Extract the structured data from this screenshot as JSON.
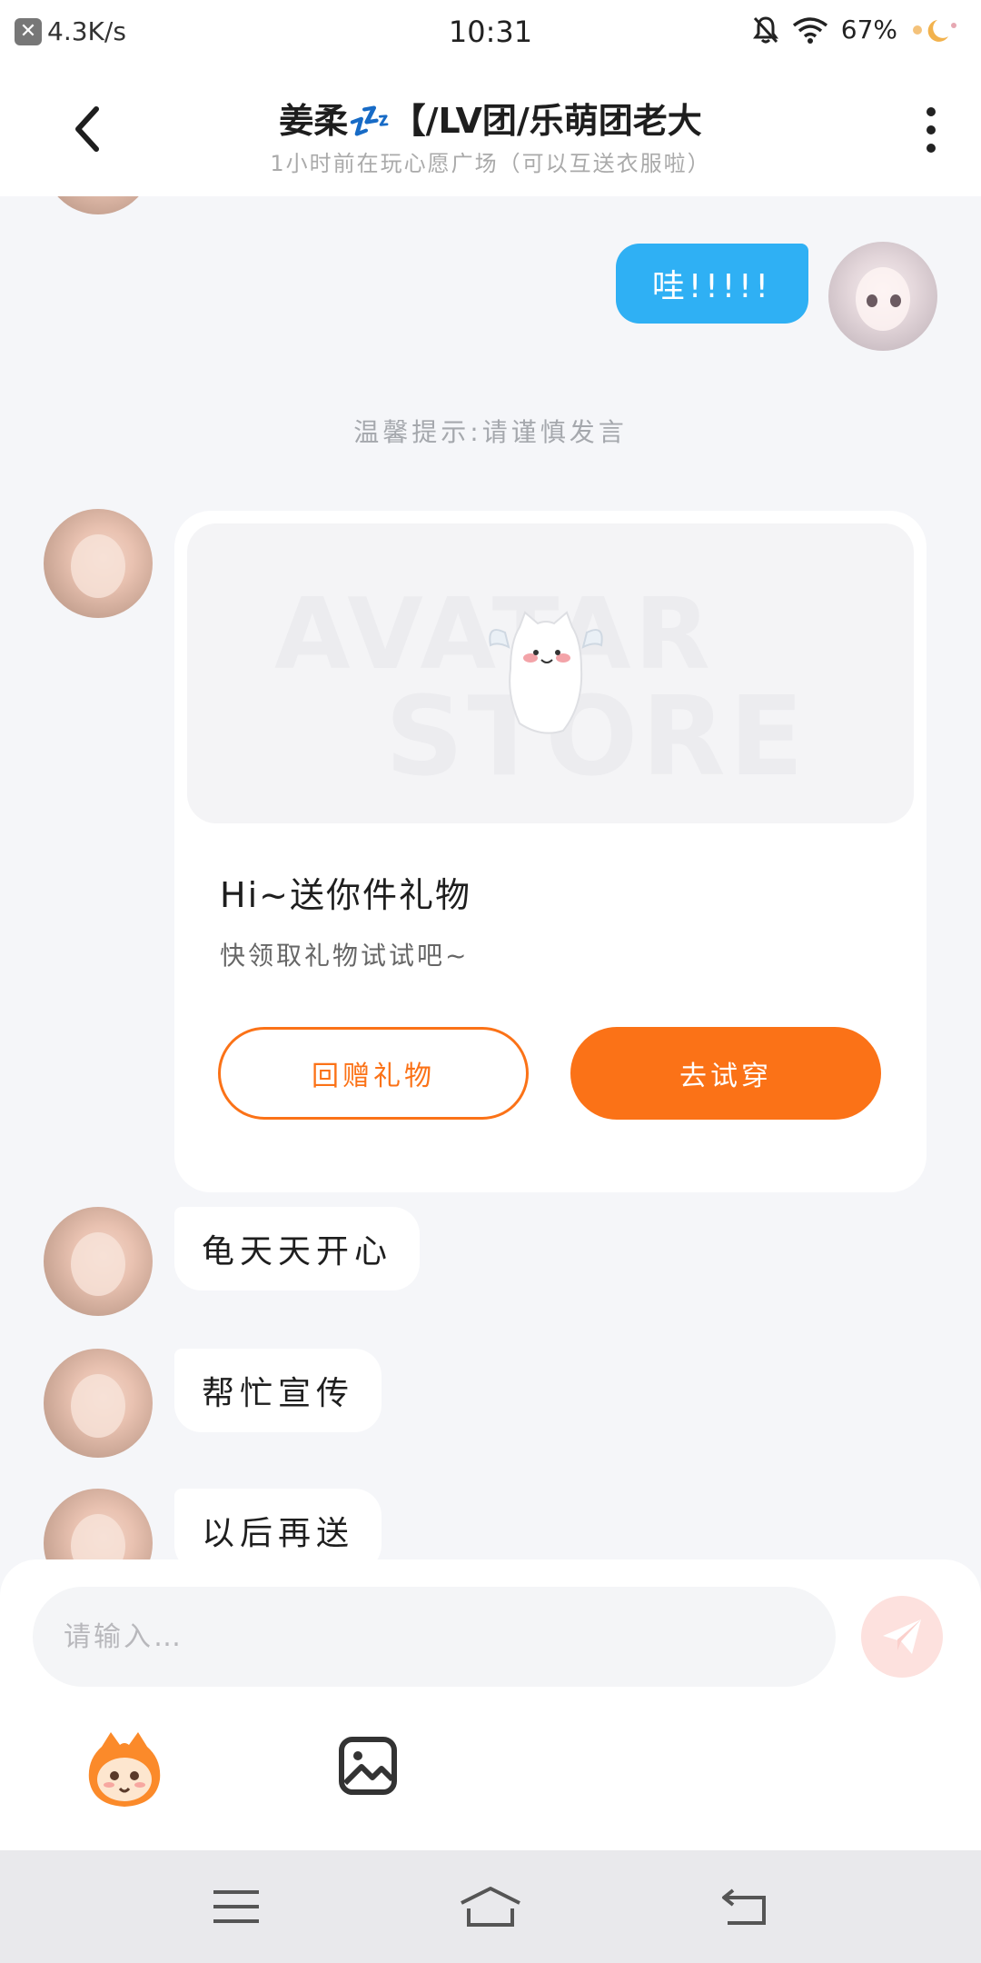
{
  "status_bar": {
    "net_speed": "4.3K/s",
    "time": "10:31",
    "battery": "67%"
  },
  "header": {
    "title": "姜柔💤【/LV团/乐萌团老大",
    "subtitle": "1小时前在玩心愿广场（可以互送衣服啦）"
  },
  "messages": {
    "outgoing_1": "哇!!!!!",
    "tip": "温馨提示:请谨慎发言",
    "gift_card": {
      "banner_line1": "AVATAR",
      "banner_line2": "STORE",
      "title": "Hi~送你件礼物",
      "subtitle": "快领取礼物试试吧~",
      "return_gift_label": "回赠礼物",
      "try_on_label": "去试穿"
    },
    "incoming_1": "龟天天开心",
    "incoming_2": "帮忙宣传",
    "incoming_3": "以后再送"
  },
  "composer": {
    "placeholder": "请输入…"
  },
  "colors": {
    "accent_orange": "#fb7217",
    "bubble_blue": "#2fb0f4"
  },
  "icons": {
    "back": "chevron-left-icon",
    "more": "more-vertical-icon",
    "send": "send-icon",
    "emoji": "emoji-mascot-icon",
    "image": "image-icon",
    "nav_menu": "menu-icon",
    "nav_home": "home-icon",
    "nav_back": "back-icon"
  }
}
